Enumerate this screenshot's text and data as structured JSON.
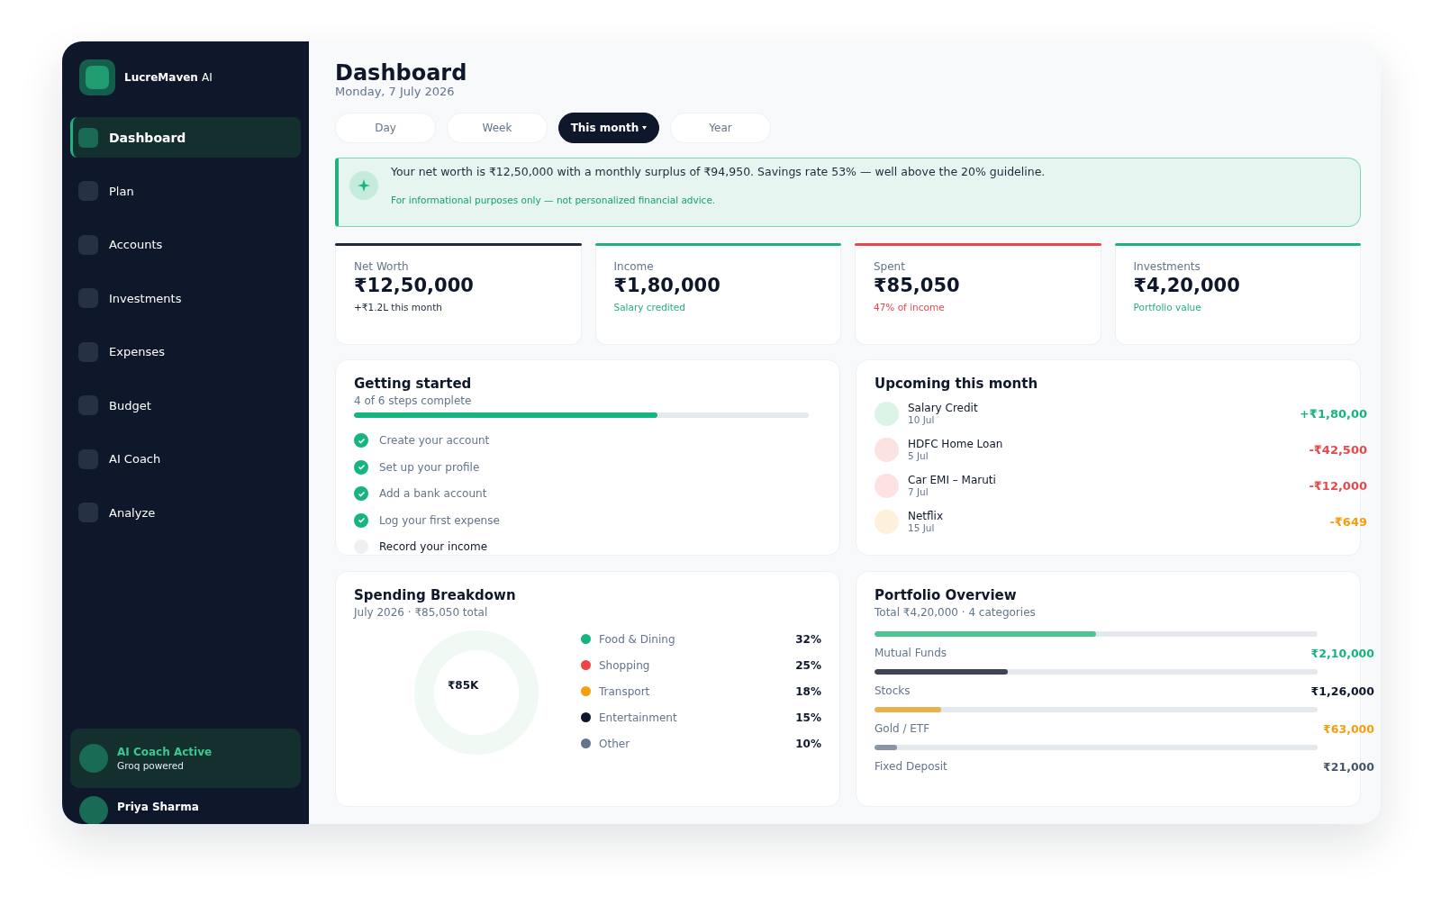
{
  "brand": {
    "name": "LucreMaven",
    "suffix": "AI"
  },
  "nav": [
    {
      "label": "Dashboard",
      "selected": true
    },
    {
      "label": "Plan",
      "selected": false
    },
    {
      "label": "Accounts",
      "selected": false
    },
    {
      "label": "Investments",
      "selected": false
    },
    {
      "label": "Expenses",
      "selected": false
    },
    {
      "label": "Budget",
      "selected": false
    },
    {
      "label": "AI Coach",
      "selected": false
    },
    {
      "label": "Analyze",
      "selected": false
    }
  ],
  "coach_status": {
    "title": "AI Coach Active",
    "subtitle": "Groq powered"
  },
  "user": {
    "name": "Priya Sharma"
  },
  "header": {
    "title": "Dashboard",
    "date": "Monday, 7 July 2026"
  },
  "periods": [
    {
      "label": "Day",
      "selected": false
    },
    {
      "label": "Week",
      "selected": false
    },
    {
      "label": "This month",
      "selected": true
    },
    {
      "label": "Year",
      "selected": false
    }
  ],
  "insight": {
    "message": "Your net worth is ₹12,50,000 with a monthly surplus of ₹94,950. Savings rate 53% — well above the 20% guideline.",
    "disclaimer": "For informational purposes only — not personalized financial advice."
  },
  "stats": [
    {
      "label": "Net Worth",
      "value": "₹12,50,000",
      "note": "+₹1.2L this month",
      "color": "#1e293b",
      "kind": "neutral"
    },
    {
      "label": "Income",
      "value": "₹1,80,000",
      "note": "Salary credited",
      "color": "#22b07d",
      "kind": "positive"
    },
    {
      "label": "Spent",
      "value": "₹85,050",
      "note": "47% of income",
      "color": "#e5484d",
      "kind": "negative"
    },
    {
      "label": "Investments",
      "value": "₹4,20,000",
      "note": "Portfolio value",
      "color": "#22b07d",
      "kind": "positive"
    }
  ],
  "getting_started": {
    "title": "Getting started",
    "progress_text": "4 of 6 steps complete",
    "level": 0.667,
    "steps": [
      {
        "label": "Create your account",
        "done": true
      },
      {
        "label": "Set up your profile",
        "done": true
      },
      {
        "label": "Add a bank account",
        "done": true
      },
      {
        "label": "Log your first expense",
        "done": true
      },
      {
        "label": "Record your income",
        "done": false
      }
    ]
  },
  "upcoming": {
    "title": "Upcoming this month",
    "items": [
      {
        "name": "Salary Credit",
        "date": "10 Jul",
        "amount": "+₹1,80,00",
        "kind": "income"
      },
      {
        "name": "HDFC Home Loan",
        "date": "5 Jul",
        "amount": "-₹42,500",
        "kind": "expense"
      },
      {
        "name": "Car EMI – Maruti",
        "date": "7 Jul",
        "amount": "-₹12,000",
        "kind": "expense"
      },
      {
        "name": "Netflix",
        "date": "15 Jul",
        "amount": "-₹649",
        "kind": "subscription"
      }
    ]
  },
  "spending": {
    "title": "Spending Breakdown",
    "period": "July 2026",
    "separator": "·",
    "total": "₹85,050 total",
    "center": "₹85K",
    "categories": [
      {
        "name": "Food & Dining",
        "percent": "32%",
        "color": "#16b47e"
      },
      {
        "name": "Shopping",
        "percent": "25%",
        "color": "#ef4444"
      },
      {
        "name": "Transport",
        "percent": "18%",
        "color": "#f59e0b"
      },
      {
        "name": "Entertainment",
        "percent": "15%",
        "color": "#0f172a"
      },
      {
        "name": "Other",
        "percent": "10%",
        "color": "#64748b"
      }
    ]
  },
  "portfolio": {
    "title": "Portfolio Overview",
    "total_label": "Total",
    "total": "₹4,20,000",
    "separator": "·",
    "count": "4 categories",
    "holdings": [
      {
        "name": "Mutual Funds",
        "value": "₹2,10,000",
        "level": 0.5,
        "color": "#4cc495",
        "kind": "positive"
      },
      {
        "name": "Stocks",
        "value": "₹1,26,000",
        "level": 0.3,
        "color": "#3f4454",
        "kind": "neutral"
      },
      {
        "name": "Gold / ETF",
        "value": "₹63,000",
        "level": 0.15,
        "color": "#eab04a",
        "kind": "warning"
      },
      {
        "name": "Fixed Deposit",
        "value": "₹21,000",
        "level": 0.05,
        "color": "#8a94a6",
        "kind": "muted"
      }
    ]
  }
}
